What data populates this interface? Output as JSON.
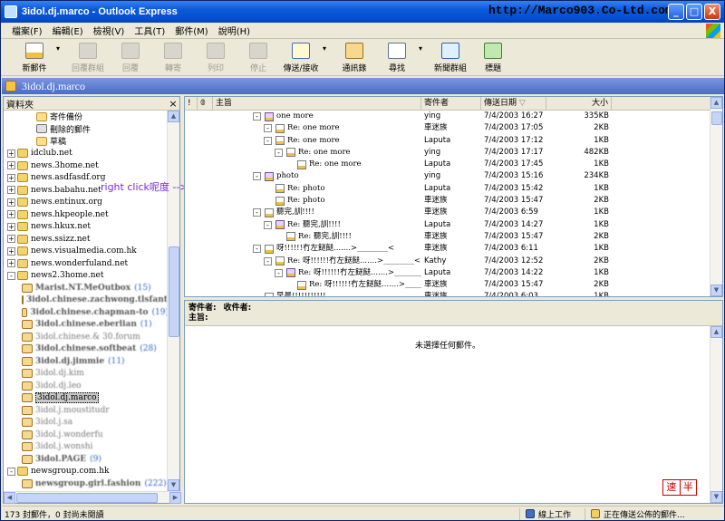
{
  "window": {
    "title": "3idol.dj.marco - Outlook Express",
    "overlay_url": "http://Marco903.Co-Ltd.com",
    "buttons": [
      "_",
      "□",
      "X"
    ]
  },
  "menu": [
    "檔案(F)",
    "編輯(E)",
    "檢視(V)",
    "工具(T)",
    "郵件(M)",
    "說明(H)"
  ],
  "toolbar": [
    {
      "label": "新郵件",
      "icon": "new-mail-icon",
      "enabled": true,
      "arrow": true
    },
    {
      "label": "回覆群組",
      "icon": "reply-group-icon",
      "enabled": false
    },
    {
      "label": "回覆",
      "icon": "reply-icon",
      "enabled": false
    },
    {
      "label": "轉寄",
      "icon": "forward-icon",
      "enabled": false
    },
    {
      "label": "列印",
      "icon": "print-icon",
      "enabled": false
    },
    {
      "label": "停止",
      "icon": "stop-icon",
      "enabled": false
    },
    {
      "label": "傳送/接收",
      "icon": "send-receive-icon",
      "enabled": true,
      "arrow": true
    },
    {
      "label": "通訊錄",
      "icon": "address-book-icon",
      "enabled": true
    },
    {
      "label": "尋找",
      "icon": "find-icon",
      "enabled": true,
      "arrow": true
    },
    {
      "label": "新聞群組",
      "icon": "newsgroups-icon",
      "enabled": true
    },
    {
      "label": "標題",
      "icon": "headers-icon",
      "enabled": true
    }
  ],
  "folder_bar": {
    "title": "3idol.dj.marco"
  },
  "folders_pane": {
    "header": "資料夾",
    "close": "×",
    "items": [
      {
        "label": "寄件備份",
        "indent": 2,
        "icon": "fold",
        "exp": ""
      },
      {
        "label": "刪除的郵件",
        "indent": 2,
        "icon": "trash",
        "exp": ""
      },
      {
        "label": "草稿",
        "indent": 2,
        "icon": "fold",
        "exp": ""
      },
      {
        "label": "idclub.net",
        "indent": 0,
        "icon": "news",
        "exp": "+"
      },
      {
        "label": "news.3home.net",
        "indent": 0,
        "icon": "news",
        "exp": "+"
      },
      {
        "label": "news.asdfasdf.org",
        "indent": 0,
        "icon": "news",
        "exp": "+"
      },
      {
        "label": "news.babahu.net",
        "indent": 0,
        "icon": "news",
        "exp": "+"
      },
      {
        "label": "news.entinux.org",
        "indent": 0,
        "icon": "news",
        "exp": "+"
      },
      {
        "label": "news.hkpeople.net",
        "indent": 0,
        "icon": "news",
        "exp": "+"
      },
      {
        "label": "news.hkux.net",
        "indent": 0,
        "icon": "news",
        "exp": "+"
      },
      {
        "label": "news.ssizz.net",
        "indent": 0,
        "icon": "news",
        "exp": "+"
      },
      {
        "label": "news.visualmedia.com.hk",
        "indent": 0,
        "icon": "news",
        "exp": "+"
      },
      {
        "label": "news.wonderfuland.net",
        "indent": 0,
        "icon": "news",
        "exp": "+"
      },
      {
        "label": "news2.3home.net",
        "indent": 0,
        "icon": "news",
        "exp": "-"
      },
      {
        "label": "Marist.NT.MeOutbox",
        "indent": 1,
        "icon": "grp",
        "blur": true,
        "count": "(15)"
      },
      {
        "label": "3idol.chinese.zachwong.tlsfantl",
        "indent": 1,
        "icon": "grp",
        "blur": true
      },
      {
        "label": "3idol.chinese.chapman-to",
        "indent": 1,
        "icon": "grp",
        "blur": true,
        "count": "(19)"
      },
      {
        "label": "3idol.chinese.eberlian",
        "indent": 1,
        "icon": "grp",
        "blur": true,
        "count": "(1)"
      },
      {
        "label": "3idol.chinese.& 30.forum",
        "indent": 1,
        "icon": "grp",
        "blur": true,
        "light": true
      },
      {
        "label": "3idol.chinese.softbeat",
        "indent": 1,
        "icon": "grp",
        "blur": true,
        "count": "(28)"
      },
      {
        "label": "3idol.dj.jimmie",
        "indent": 1,
        "icon": "grp",
        "blur": true,
        "count": "(11)"
      },
      {
        "label": "3idol.dj.kim",
        "indent": 1,
        "icon": "grp",
        "blur": true,
        "light": true
      },
      {
        "label": "3idol.dj.leo",
        "indent": 1,
        "icon": "grp",
        "blur": true,
        "light": true
      },
      {
        "label": "3idol.dj.marco",
        "indent": 1,
        "icon": "grp",
        "selected": true
      },
      {
        "label": "3idol.j.moustitudr",
        "indent": 1,
        "icon": "grp",
        "blur": true,
        "light": true
      },
      {
        "label": "3idol.j.sa",
        "indent": 1,
        "icon": "grp",
        "blur": true,
        "light": true
      },
      {
        "label": "3idol.j.wonderfu",
        "indent": 1,
        "icon": "grp",
        "blur": true,
        "light": true
      },
      {
        "label": "3idol.j.wonshi",
        "indent": 1,
        "icon": "grp",
        "blur": true,
        "light": true
      },
      {
        "label": "3idol.PAGE",
        "indent": 1,
        "icon": "grp",
        "blur": true,
        "count": "(9)"
      },
      {
        "label": "newsgroup.com.hk",
        "indent": 0,
        "icon": "news",
        "exp": "-"
      },
      {
        "label": "newsgroup.girl.fashion",
        "indent": 1,
        "icon": "grp",
        "blur": true,
        "count": "(222)"
      }
    ],
    "annotation": "right click呢度 --> 內容"
  },
  "message_list": {
    "columns": {
      "flag": "!",
      "attach": "𝟘",
      "subject": "主旨",
      "from": "寄件者",
      "date": "傳送日期",
      "date_sort": "▽",
      "size": "大小"
    },
    "rows": [
      {
        "indent": 0,
        "toggle": "-",
        "att": true,
        "subject": "one more",
        "from": "ying",
        "date": "7/4/2003 16:27",
        "size": "335KB"
      },
      {
        "indent": 1,
        "toggle": "-",
        "subject": "Re: one more",
        "from": "車迷族",
        "date": "7/4/2003 17:05",
        "size": "2KB"
      },
      {
        "indent": 1,
        "toggle": "-",
        "subject": "Re: one more",
        "from": "Laputa",
        "date": "7/4/2003 17:12",
        "size": "1KB"
      },
      {
        "indent": 2,
        "toggle": "-",
        "subject": "Re: one more",
        "from": "ying",
        "date": "7/4/2003 17:17",
        "size": "482KB"
      },
      {
        "indent": 3,
        "toggle": "",
        "subject": "Re: one more",
        "from": "Laputa",
        "date": "7/4/2003 17:45",
        "size": "1KB"
      },
      {
        "indent": 0,
        "toggle": "-",
        "att": true,
        "subject": "photo",
        "from": "ying",
        "date": "7/4/2003 15:16",
        "size": "234KB"
      },
      {
        "indent": 1,
        "toggle": "",
        "subject": "Re: photo",
        "from": "Laputa",
        "date": "7/4/2003 15:42",
        "size": "1KB"
      },
      {
        "indent": 1,
        "toggle": "",
        "subject": "Re: photo",
        "from": "車迷族",
        "date": "7/4/2003 15:47",
        "size": "2KB"
      },
      {
        "indent": 0,
        "toggle": "-",
        "subject": "聽完,訓!!!!",
        "from": "車迷族",
        "date": "7/4/2003 6:59",
        "size": "1KB"
      },
      {
        "indent": 1,
        "toggle": "-",
        "att": true,
        "subject": "Re: 聽完,訓!!!!",
        "from": "Laputa",
        "date": "7/4/2003 14:27",
        "size": "1KB"
      },
      {
        "indent": 2,
        "toggle": "",
        "subject": "Re: 聽完,訓!!!!",
        "from": "車迷族",
        "date": "7/4/2003 15:47",
        "size": "2KB"
      },
      {
        "indent": 0,
        "toggle": "-",
        "subject": "呀!!!!!!冇左餸餸.......>________<",
        "from": "車迷族",
        "date": "7/4/2003 6:11",
        "size": "1KB"
      },
      {
        "indent": 1,
        "toggle": "-",
        "subject": "Re: 呀!!!!!!冇左餸餸.......>________<",
        "from": "Kathy",
        "date": "7/4/2003 12:52",
        "size": "2KB"
      },
      {
        "indent": 2,
        "toggle": "-",
        "att": true,
        "subject": "Re: 呀!!!!!!冇左餸餸.......>________<",
        "from": "Laputa",
        "date": "7/4/2003 14:22",
        "size": "1KB"
      },
      {
        "indent": 3,
        "toggle": "",
        "subject": "Re: 呀!!!!!!冇左餸餸.......>________<",
        "from": "車迷族",
        "date": "7/4/2003 15:47",
        "size": "2KB"
      },
      {
        "indent": 0,
        "toggle": "",
        "subject": "早晨!!!!!!!!!!!",
        "from": "車迷族",
        "date": "7/4/2003 6:03",
        "size": "1KB"
      }
    ]
  },
  "preview": {
    "from_label": "寄件者:",
    "to_label": "收件者:",
    "subject_label": "主旨:",
    "empty_text": "未選擇任何郵件。",
    "stamp": [
      "速",
      "半"
    ]
  },
  "status": {
    "count_text": "173 封郵件，0 封尚未閱讀",
    "online": "線上工作",
    "sending": "正在傳送公佈的郵件..."
  }
}
